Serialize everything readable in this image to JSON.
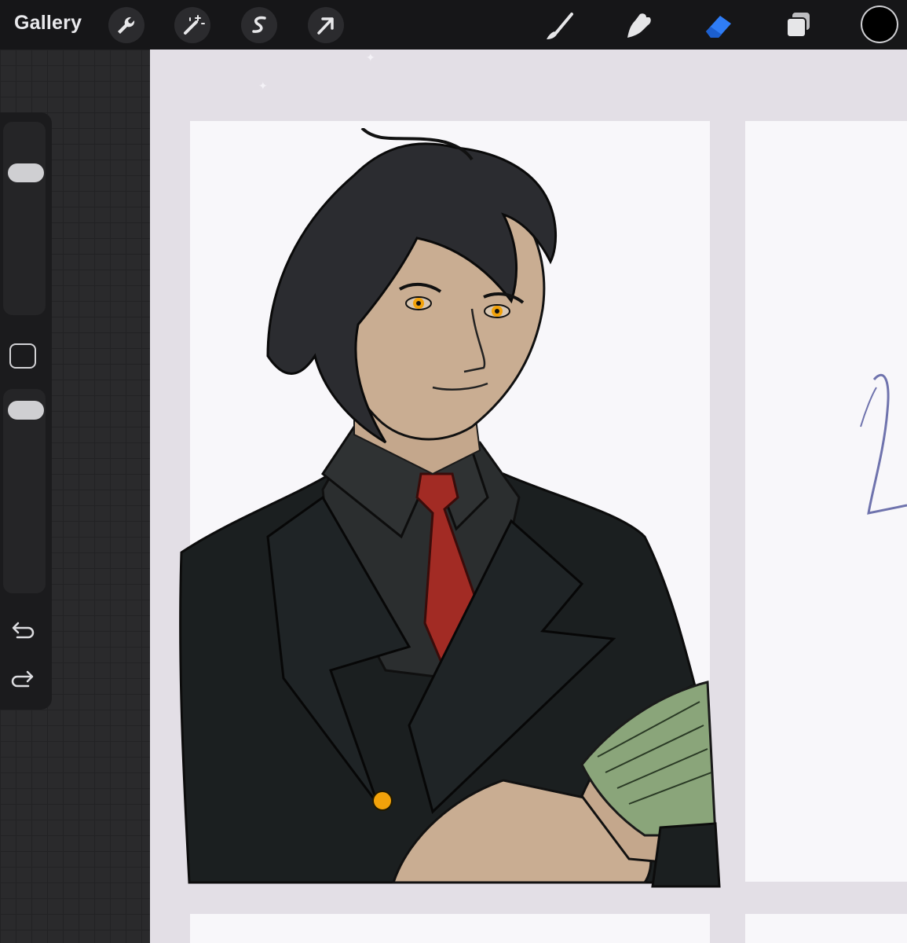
{
  "toolbar": {
    "gallery_label": "Gallery",
    "left_tools": [
      {
        "icon": "wrench-icon",
        "name": "actions"
      },
      {
        "icon": "magic-wand-icon",
        "name": "adjustments"
      },
      {
        "icon": "selection-s-icon",
        "name": "selection"
      },
      {
        "icon": "arrow-cursor-icon",
        "name": "transform"
      }
    ],
    "right_tools": [
      {
        "icon": "brush-icon",
        "name": "paint"
      },
      {
        "icon": "smudge-icon",
        "name": "smudge"
      },
      {
        "icon": "eraser-icon",
        "name": "erase",
        "active": true
      },
      {
        "icon": "layers-icon",
        "name": "layers"
      }
    ],
    "current_color": "#000000",
    "active_tool_color": "#2f7df6"
  },
  "sidebar": {
    "brush_size_level": 0.77,
    "brush_opacity_level": 0.95,
    "modify_button_icon": "square-icon",
    "undo_icon": "undo-arrow-icon",
    "redo_icon": "redo-arrow-icon"
  },
  "canvas": {
    "background_color": "#e3dfe6",
    "artwork": {
      "subject": "illustration-man-in-black-suit",
      "hair_color": "#2b2c30",
      "skin_color": "#c9ad92",
      "suit_color": "#1b1f20",
      "tie_color": "#a22b24",
      "money_color": "#8aa57a",
      "button_color": "#f2a20a"
    }
  }
}
